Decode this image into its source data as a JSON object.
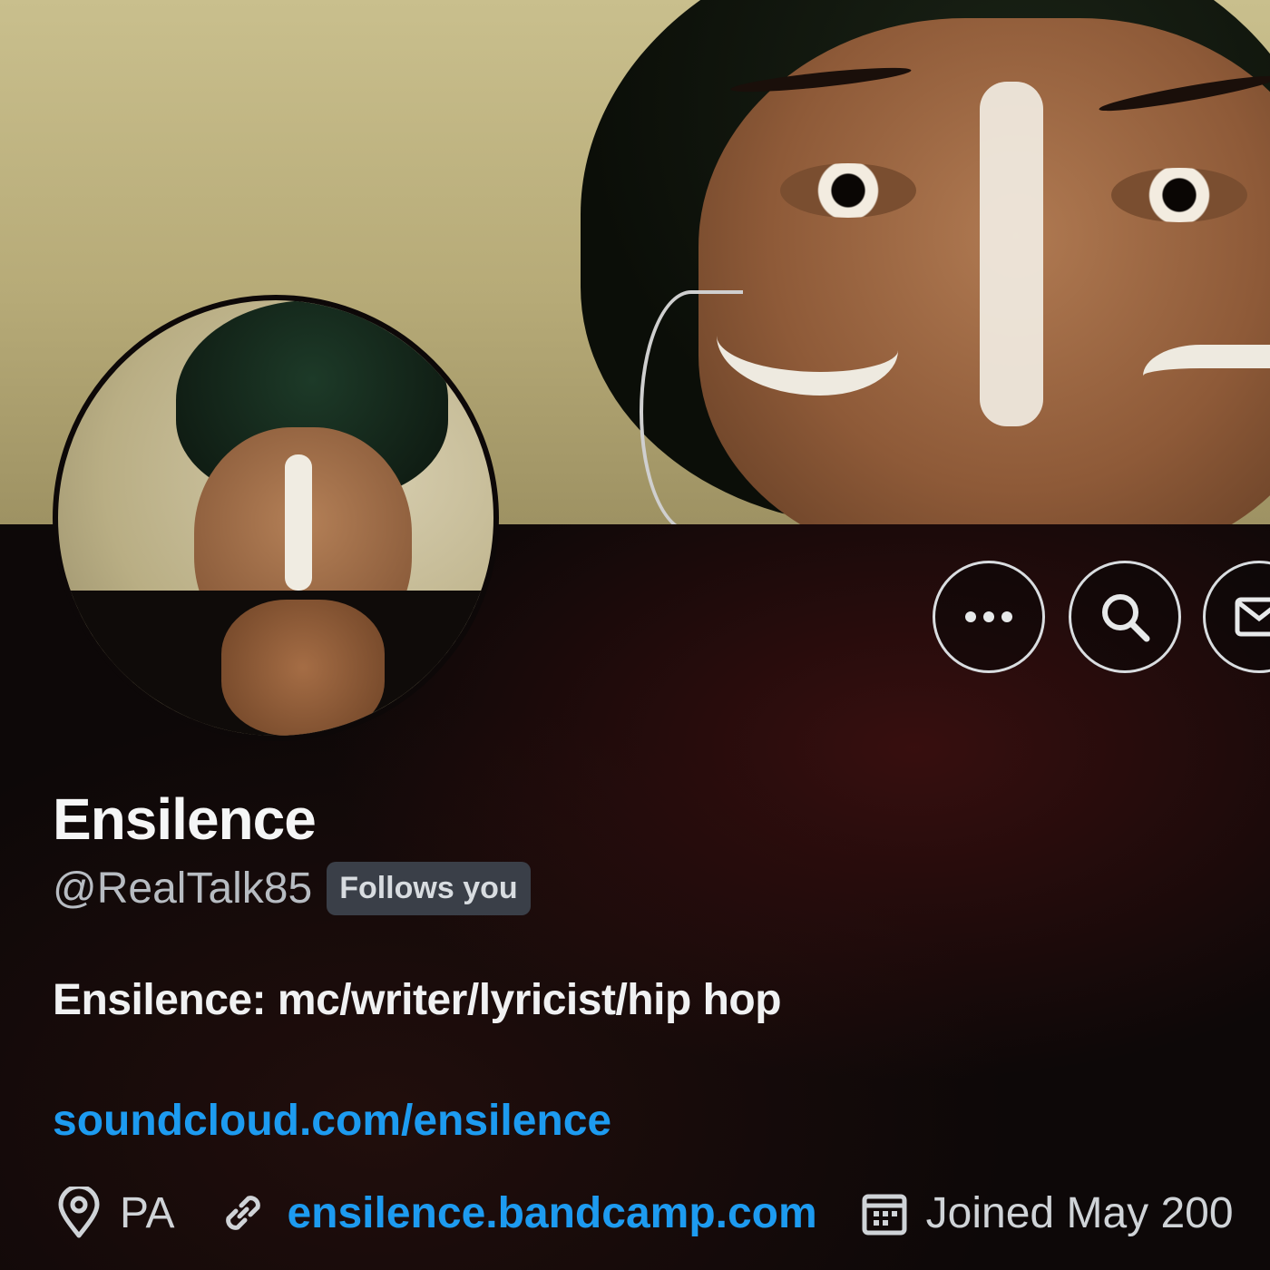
{
  "profile": {
    "display_name": "Ensilence",
    "handle": "@RealTalk85",
    "follows_you_badge": "Follows you",
    "bio": "Ensilence: mc/writer/lyricist/hip hop",
    "bio_link": "soundcloud.com/ensilence",
    "location": "PA",
    "website": "ensilence.bandcamp.com",
    "joined": "Joined May 200"
  },
  "actions": {
    "more_icon": "more-horizontal-icon",
    "search_icon": "search-icon",
    "message_icon": "mail-icon"
  },
  "icons": {
    "location": "map-pin-icon",
    "website": "link-icon",
    "joined": "calendar-icon"
  },
  "colors": {
    "link": "#1d9bf0",
    "background": "#0c0708",
    "badge": "#3a3f48",
    "primary_text": "#f5f6f6",
    "secondary_text": "#b7bcc2"
  }
}
